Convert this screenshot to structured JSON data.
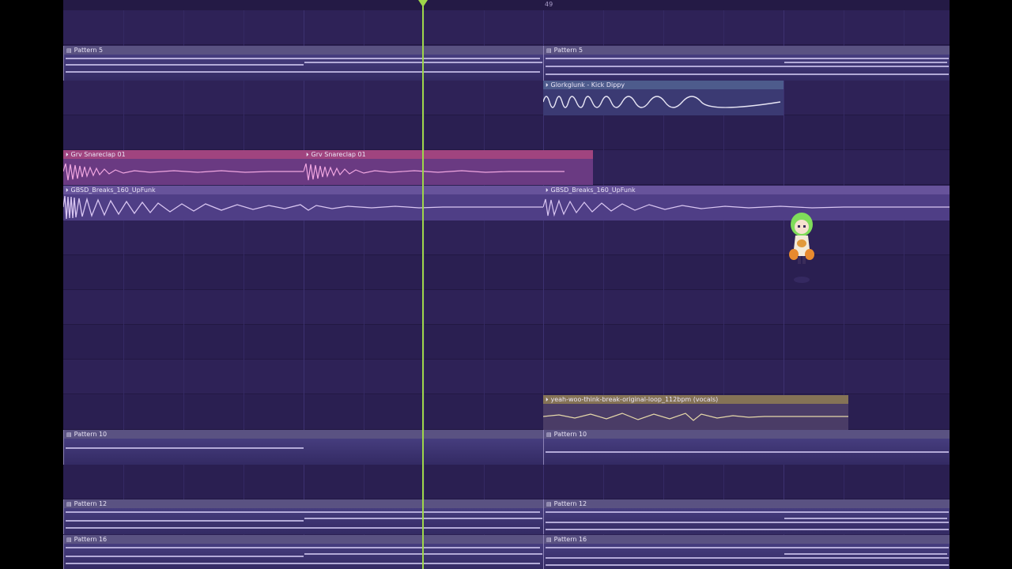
{
  "ruler": {
    "marker_label": "49"
  },
  "clips": {
    "pattern5_a": "Pattern 5",
    "pattern5_b": "Pattern 5",
    "kick": "Glorkglunk - Kick Dippy",
    "snare_a": "Grv Snareclap 01",
    "snare_b": "Grv Snareclap 01",
    "breaks_a": "GBSD_Breaks_160_UpFunk",
    "breaks_b": "GBSD_Breaks_160_UpFunk",
    "vocals": "yeah-woo-think-break-original-loop_112bpm (vocals)",
    "pattern10_a": "Pattern 10",
    "pattern10_b": "Pattern 10",
    "pattern12_a": "Pattern 12",
    "pattern12_b": "Pattern 12",
    "pattern16_a": "Pattern 16",
    "pattern16_b": "Pattern 16"
  },
  "icons": {
    "pattern_clip": "pattern-clip-icon",
    "audio_clip": "audio-clip-icon",
    "playhead": "playhead-marker",
    "mascot": "fl-chan-mascot"
  },
  "colors": {
    "background": "#2c2054",
    "playhead": "#9ed64a",
    "snare_clip": "#a0447f",
    "vocals_clip": "#857356"
  }
}
